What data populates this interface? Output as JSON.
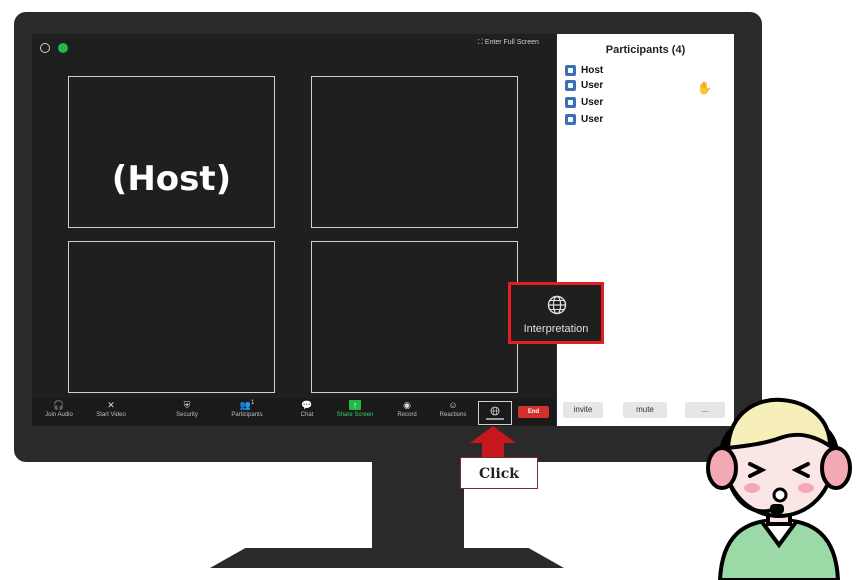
{
  "meeting": {
    "host_tile_label": "(Host)",
    "fullscreen_label": "Enter Full Screen"
  },
  "toolbar": {
    "items": [
      {
        "label": "Join Audio",
        "icon": "headphones-icon"
      },
      {
        "label": "Start Video",
        "icon": "video-off-icon"
      },
      {
        "label": "Security",
        "icon": "shield-icon"
      },
      {
        "label": "Participants",
        "icon": "participants-icon",
        "count": "1"
      },
      {
        "label": "Chat",
        "icon": "chat-icon"
      },
      {
        "label": "Share Screen",
        "icon": "share-screen-icon"
      },
      {
        "label": "Record",
        "icon": "record-icon"
      },
      {
        "label": "Reactions",
        "icon": "reactions-icon"
      }
    ],
    "end_label": "End"
  },
  "participants": {
    "title": "Participants (4)",
    "list": [
      {
        "name": "Host"
      },
      {
        "name": "User",
        "raised_hand": true
      },
      {
        "name": "User"
      },
      {
        "name": "User"
      }
    ],
    "buttons": {
      "invite": "invite",
      "mute": "mute",
      "more": "..."
    }
  },
  "callout": {
    "label": "Interpretation",
    "icon": "globe-icon",
    "border_color": "#e31e24"
  },
  "instruction": {
    "click_label": "Click",
    "arrow_color": "#c8161d"
  }
}
